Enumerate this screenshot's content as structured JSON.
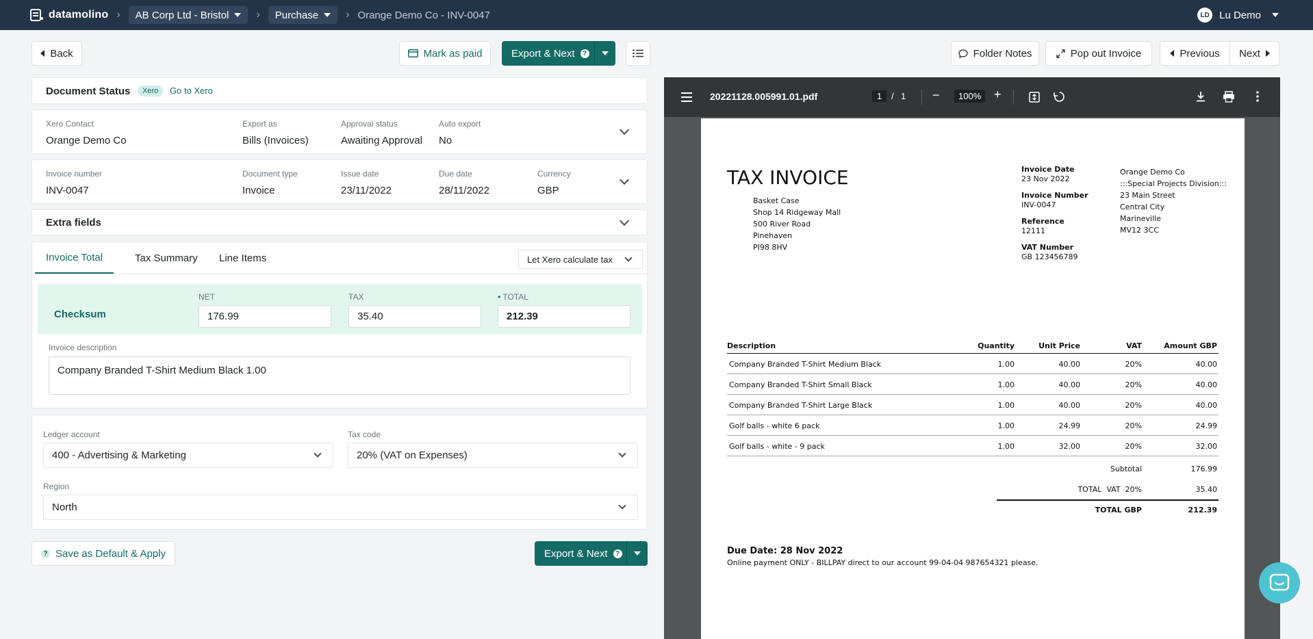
{
  "nav": {
    "logo": "datamolino",
    "company": "AB Corp Ltd - Bristol",
    "section": "Purchase",
    "document": "Orange Demo Co - INV-0047",
    "user_initials": "LD",
    "user_name": "Lu Demo"
  },
  "toolbar": {
    "back": "Back",
    "mark_paid": "Mark as paid",
    "export_next": "Export & Next",
    "folder_notes": "Folder Notes",
    "pop_out": "Pop out Invoice",
    "previous": "Previous",
    "next": "Next"
  },
  "status": {
    "title": "Document Status",
    "badge": "Xero",
    "link": "Go to Xero"
  },
  "contact": {
    "contact_label": "Xero Contact",
    "contact_value": "Orange Demo Co",
    "export_label": "Export as",
    "export_value": "Bills (Invoices)",
    "approval_label": "Approval status",
    "approval_value": "Awaiting Approval",
    "auto_label": "Auto export",
    "auto_value": "No"
  },
  "invoice": {
    "number_label": "Invoice number",
    "number_value": "INV-0047",
    "type_label": "Document type",
    "type_value": "Invoice",
    "issue_label": "Issue date",
    "issue_value": "23/11/2022",
    "due_label": "Due date",
    "due_value": "28/11/2022",
    "currency_label": "Currency",
    "currency_value": "GBP"
  },
  "extra_fields": "Extra fields",
  "tabs": [
    "Invoice Total",
    "Tax Summary",
    "Line Items"
  ],
  "tax_mode": "Let Xero calculate tax",
  "checksum": {
    "label": "Checksum",
    "net_label": "NET",
    "net_value": "176.99",
    "tax_label": "TAX",
    "tax_value": "35.40",
    "total_label": "TOTAL",
    "total_value": "212.39"
  },
  "description": {
    "label": "Invoice description",
    "value": "Company Branded T-Shirt Medium Black 1.00"
  },
  "coding": {
    "ledger_label": "Ledger account",
    "ledger_value": "400 - Advertising & Marketing",
    "taxcode_label": "Tax code",
    "taxcode_value": "20% (VAT on Expenses)",
    "region_label": "Region",
    "region_value": "North"
  },
  "footer": {
    "save_default": "Save as Default & Apply",
    "export_next": "Export & Next"
  },
  "pdf": {
    "filename": "20221128.005991.01.pdf",
    "page_current": "1",
    "page_sep": "/",
    "page_total": "1",
    "zoom": "100%",
    "title": "TAX INVOICE",
    "bill_to": [
      "Basket Case",
      "Shop 14 Ridgeway Mall",
      "500 River Road",
      "Pinehaven",
      "PI98 8HV"
    ],
    "invoice_date_label": "Invoice Date",
    "invoice_date": "23 Nov 2022",
    "invoice_number_label": "Invoice Number",
    "invoice_number": "INV-0047",
    "reference_label": "Reference",
    "reference": "12111",
    "vat_label": "VAT Number",
    "vat": "GB 123456789",
    "from": [
      "Orange Demo Co",
      ":::Special Projects Division:::",
      "23 Main Street",
      "Central City",
      "Marineville",
      "MV12 3CC"
    ],
    "headers": [
      "Description",
      "Quantity",
      "Unit Price",
      "VAT",
      "Amount GBP"
    ],
    "rows": [
      [
        "Company Branded T-Shirt Medium Black",
        "1.00",
        "40.00",
        "20%",
        "40.00"
      ],
      [
        "Company Branded T-Shirt Small Black",
        "1.00",
        "40.00",
        "20%",
        "40.00"
      ],
      [
        "Company Branded T-Shirt Large Black",
        "1.00",
        "40.00",
        "20%",
        "40.00"
      ],
      [
        "Golf balls - white 6 pack",
        "1.00",
        "24.99",
        "20%",
        "24.99"
      ],
      [
        "Golf balls - white - 9 pack",
        "1.00",
        "32.00",
        "20%",
        "32.00"
      ]
    ],
    "subtotal_label": "Subtotal",
    "subtotal": "176.99",
    "vat_total_label": "TOTAL  VAT  20%",
    "vat_total": "35.40",
    "total_label": "TOTAL GBP",
    "total": "212.39",
    "due_line": "Due Date: 28 Nov 2022",
    "payment_line": "Online payment ONLY - BILLPAY direct to our account 99-04-04 987654321 please."
  }
}
